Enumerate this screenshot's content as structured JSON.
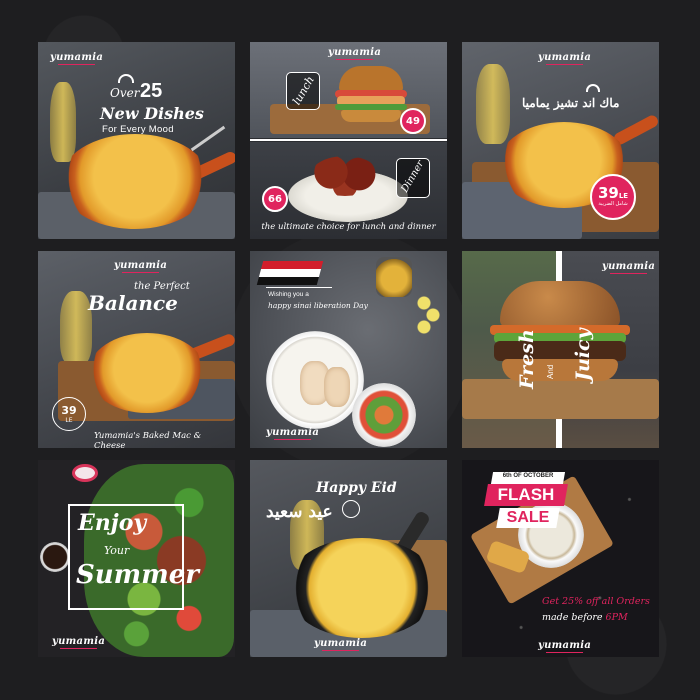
{
  "brand": "yumamia",
  "tiles": {
    "t1": {
      "over": "Over",
      "count": "25",
      "headline": "New Dishes",
      "sub": "For Every Mood"
    },
    "t2": {
      "lunch": "lunch",
      "lunch_price": "49",
      "dinner": "Dinner",
      "dinner_price": "66",
      "tagline": "the ultimate choice for lunch and dinner"
    },
    "t3": {
      "arabic": "ماك اند تشيز يماميا",
      "price": "39",
      "price_unit": "LE",
      "price_arabic": "شامل الضريبة"
    },
    "t4": {
      "line1": "the Perfect",
      "line2": "Balance",
      "price": "39",
      "price_unit": "LE",
      "caption": "Yumamia's Baked Mac & Cheese"
    },
    "t5": {
      "line1": "Wishing you a",
      "line2": "happy sinai liberation Day"
    },
    "t6": {
      "word1": "Fresh",
      "word2": "And",
      "word3": "Juicy"
    },
    "t7": {
      "line1": "Enjoy",
      "line2": "Your",
      "line3": "Summer"
    },
    "t8": {
      "greeting": "Happy Eid",
      "arabic": "عيد سعيد"
    },
    "t9": {
      "date": "6th OF OCTOBER",
      "flash": "FLASH",
      "sale": "SALE",
      "offer1": "Get 25% off all Orders",
      "offer2_pre": "made before ",
      "offer2_time": "6PM"
    }
  },
  "colors": {
    "accent": "#e0245e",
    "background": "#1e1e20"
  }
}
